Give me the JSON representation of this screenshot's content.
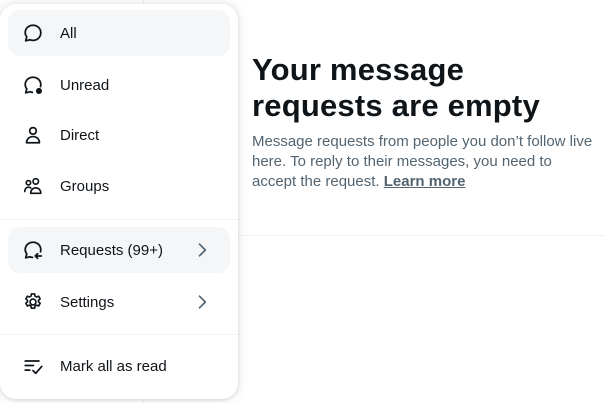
{
  "empty_state": {
    "title": "Your message requests are empty",
    "body": "Message requests from people you don’t follow live here. To reply to their messages, you need to accept the request. ",
    "link": "Learn more"
  },
  "menu": {
    "items": [
      {
        "label": "All",
        "icon": "chat-bubble-icon"
      },
      {
        "label": "Unread",
        "icon": "chat-bubble-unread-icon"
      },
      {
        "label": "Direct",
        "icon": "person-icon"
      },
      {
        "label": "Groups",
        "icon": "group-icon"
      },
      {
        "label": "Requests (99+)",
        "icon": "chat-bubble-request-icon"
      },
      {
        "label": "Settings",
        "icon": "gear-icon"
      },
      {
        "label": "Mark all as read",
        "icon": "check-list-icon"
      }
    ]
  },
  "colors": {
    "text": "#0f1419",
    "secondary_text": "#536471",
    "active_bg": "#f4f6f7",
    "divider": "#eff3f4"
  }
}
